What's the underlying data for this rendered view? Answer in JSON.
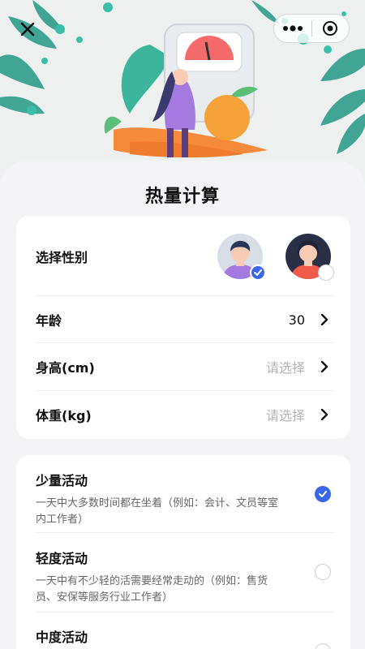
{
  "page": {
    "title": "热量计算"
  },
  "form": {
    "gender": {
      "label": "选择性别",
      "selected": "male"
    },
    "age": {
      "label": "年龄",
      "value": "30"
    },
    "height": {
      "label": "身高(cm)",
      "placeholder": "请选择"
    },
    "weight": {
      "label": "体重(kg)",
      "placeholder": "请选择"
    }
  },
  "activities": [
    {
      "name": "少量活动",
      "desc": "一天中大多数时间都在坐着（例如：会计、文员等室内工作者）",
      "selected": true
    },
    {
      "name": "轻度活动",
      "desc": "一天中有不少轻的活需要经常走动的（例如：售货员、安保等服务行业工作者）",
      "selected": false
    },
    {
      "name": "中度活动",
      "desc": "",
      "selected": false
    }
  ],
  "icons": {
    "close": "close-icon",
    "more": "more-dots-icon",
    "exit": "target-icon",
    "chevron": "chevron-right-icon"
  },
  "colors": {
    "accent": "#3a66e8",
    "avatar_male_bg": "#d8dde6",
    "avatar_female_bg": "#f05a4a"
  }
}
